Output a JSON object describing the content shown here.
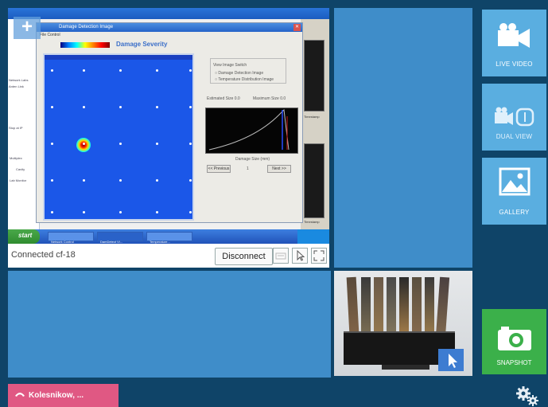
{
  "remote_screen": {
    "inner_window_title": "Damage Detection Image",
    "inner_window_menu": "File  Control",
    "chart_title": "Damage Severity",
    "radio_group_label": "View Image Switch",
    "radio_option_1": "Damage Detection Image",
    "radio_option_2": "Temperature Distribution Image",
    "estimated_size_label": "Estimated Size",
    "estimated_size_value": "0.0",
    "maximum_size_label": "Maximum Size",
    "maximum_size_value": "0.0",
    "damage_size_label": "Damage Size (mm)",
    "prev_button": "<< Previous",
    "next_button": "Next >>",
    "page_indicator": "1",
    "left_panel_lines": [
      "Network Labs",
      "Anten Link",
      "Stop at IP",
      "Multiplex",
      "Cavity",
      "Lab Monitor"
    ],
    "right_panel_tag": "Timestamp",
    "start_label": "start",
    "taskbar_tasks": [
      "Network Control",
      "DamDetect Vi...",
      "Temperature..."
    ]
  },
  "plus_button": "+",
  "control_bar": {
    "status": "Connected cf-18",
    "disconnect_label": "Disconnect"
  },
  "side_tiles": {
    "live_video": "LIVE VIDEO",
    "dual_view": "DUAL VIEW",
    "gallery": "GALLERY",
    "snapshot": "SNAPSHOT"
  },
  "call": {
    "label": "Kolesnikow, ..."
  },
  "colors": {
    "background": "#0f4468",
    "tile_blue": "#5aaee0",
    "snapshot_green": "#3bb04a",
    "call_pink": "#e05883"
  }
}
